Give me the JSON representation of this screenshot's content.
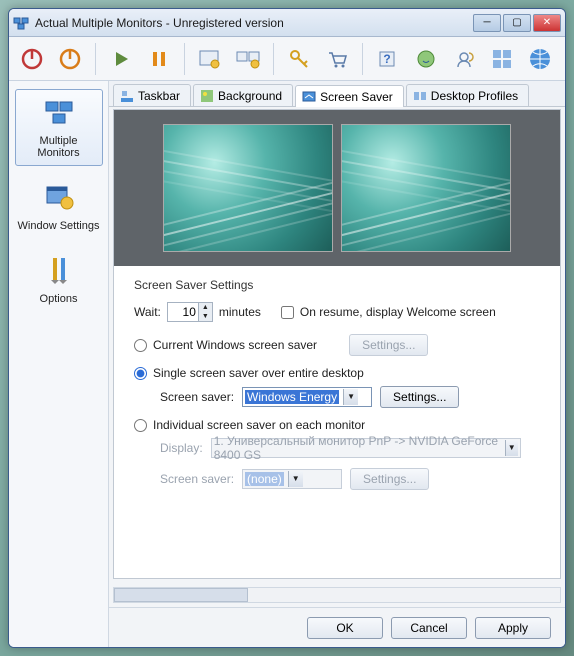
{
  "title": "Actual Multiple Monitors - Unregistered version",
  "sidebar": {
    "items": [
      {
        "label": "Multiple Monitors",
        "selected": true
      },
      {
        "label": "Window Settings",
        "selected": false
      },
      {
        "label": "Options",
        "selected": false
      }
    ]
  },
  "tabs": [
    {
      "label": "Taskbar",
      "active": false
    },
    {
      "label": "Background",
      "active": false
    },
    {
      "label": "Screen Saver",
      "active": true
    },
    {
      "label": "Desktop Profiles",
      "active": false
    }
  ],
  "screensaver": {
    "group_title": "Screen Saver Settings",
    "wait_label": "Wait:",
    "wait_value": "10",
    "wait_unit": "minutes",
    "resume_label": "On resume, display Welcome screen",
    "resume_checked": false,
    "opt_current_label": "Current Windows screen saver",
    "opt_single_label": "Single screen saver over entire desktop",
    "opt_individual_label": "Individual screen saver on each monitor",
    "selected_option": "single",
    "settings_btn": "Settings...",
    "single": {
      "label": "Screen saver:",
      "value": "Windows Energy"
    },
    "individual": {
      "display_label": "Display:",
      "display_value": "1. Универсальный монитор PnP -> NVIDIA GeForce 8400 GS",
      "saver_label": "Screen saver:",
      "saver_value": "(none)"
    }
  },
  "footer": {
    "ok": "OK",
    "cancel": "Cancel",
    "apply": "Apply"
  }
}
